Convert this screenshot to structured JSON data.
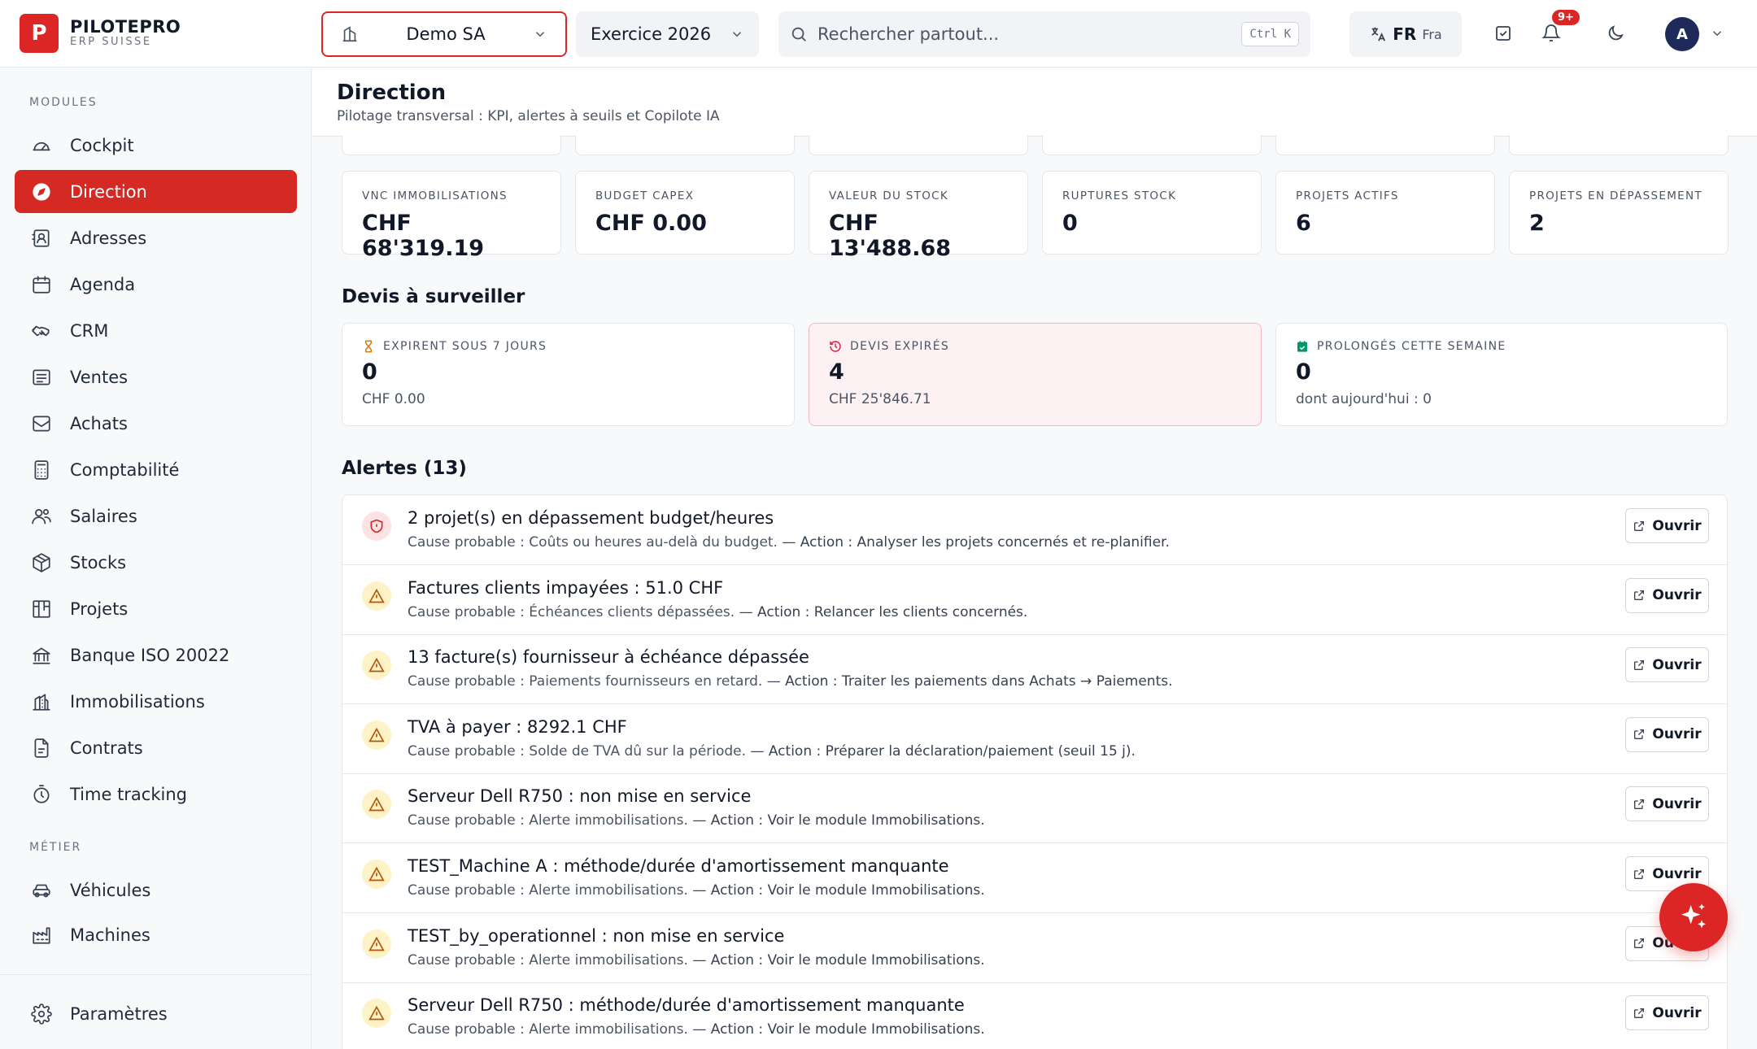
{
  "brand": {
    "name": "PILOTEPRO",
    "tagline": "ERP SUISSE",
    "logo_letter": "P",
    "accent": "#dc2626"
  },
  "header": {
    "company": "Demo SA",
    "year": "Exercice 2026",
    "search_placeholder": "Rechercher partout...",
    "search_shortcut": "Ctrl K",
    "lang_code": "FR",
    "lang_name": "Fra",
    "notif_count": "9+",
    "avatar": "A"
  },
  "sidebar": {
    "modules_label": "MODULES",
    "modules": [
      {
        "label": "Cockpit",
        "icon": "gauge-icon"
      },
      {
        "label": "Direction",
        "icon": "compass-icon",
        "active": true
      },
      {
        "label": "Adresses",
        "icon": "contact-icon"
      },
      {
        "label": "Agenda",
        "icon": "calendar-icon"
      },
      {
        "label": "CRM",
        "icon": "handshake-icon"
      },
      {
        "label": "Ventes",
        "icon": "receipt-icon"
      },
      {
        "label": "Achats",
        "icon": "inbox-icon"
      },
      {
        "label": "Comptabilité",
        "icon": "calculator-icon"
      },
      {
        "label": "Salaires",
        "icon": "users-icon"
      },
      {
        "label": "Stocks",
        "icon": "box-icon"
      },
      {
        "label": "Projets",
        "icon": "kanban-icon"
      },
      {
        "label": "Banque ISO 20022",
        "icon": "bank-icon"
      },
      {
        "label": "Immobilisations",
        "icon": "building-icon"
      },
      {
        "label": "Contrats",
        "icon": "contract-icon"
      },
      {
        "label": "Time tracking",
        "icon": "timer-icon"
      }
    ],
    "metier_label": "MÉTIER",
    "metier": [
      {
        "label": "Véhicules",
        "icon": "car-icon"
      },
      {
        "label": "Machines",
        "icon": "factory-icon"
      }
    ],
    "settings": "Paramètres"
  },
  "page": {
    "title": "Direction",
    "subtitle": "Pilotage transversal : KPI, alertes à seuils et Copilote IA"
  },
  "kpis": [
    {
      "label": "VNC IMMOBILISATIONS",
      "value": "CHF 68'319.19"
    },
    {
      "label": "BUDGET CAPEX",
      "value": "CHF 0.00"
    },
    {
      "label": "VALEUR DU STOCK",
      "value": "CHF 13'488.68"
    },
    {
      "label": "RUPTURES STOCK",
      "value": "0"
    },
    {
      "label": "PROJETS ACTIFS",
      "value": "6"
    },
    {
      "label": "PROJETS EN DÉPASSEMENT",
      "value": "2"
    }
  ],
  "devis": {
    "title": "Devis à surveiller",
    "cards": [
      {
        "label": "EXPIRENT SOUS 7 JOURS",
        "value": "0",
        "sub": "CHF 0.00"
      },
      {
        "label": "DEVIS EXPIRÉS",
        "value": "4",
        "sub": "CHF 25'846.71"
      },
      {
        "label": "PROLONGÉS CETTE SEMAINE",
        "value": "0",
        "sub": "dont aujourd'hui : 0"
      }
    ]
  },
  "alerts": {
    "title": "Alertes (13)",
    "open_label": "Ouvrir",
    "items": [
      {
        "title": "2 projet(s) en dépassement budget/heures",
        "cause": "Cause probable : Coûts ou heures au-delà du budget.",
        "action": " — Action : Analyser les projets concernés et re-planifier.",
        "level": "danger"
      },
      {
        "title": "Factures clients impayées : 51.0 CHF",
        "cause": "Cause probable : Échéances clients dépassées.",
        "action": " — Action : Relancer les clients concernés.",
        "level": "warning"
      },
      {
        "title": "13 facture(s) fournisseur à échéance dépassée",
        "cause": "Cause probable : Paiements fournisseurs en retard.",
        "action": " — Action : Traiter les paiements dans Achats → Paiements.",
        "level": "warning"
      },
      {
        "title": "TVA à payer : 8292.1 CHF",
        "cause": "Cause probable : Solde de TVA dû sur la période.",
        "action": " — Action : Préparer la déclaration/paiement (seuil 15 j).",
        "level": "warning"
      },
      {
        "title": "Serveur Dell R750 : non mise en service",
        "cause": "Cause probable : Alerte immobilisations.",
        "action": " — Action : Voir le module Immobilisations.",
        "level": "warning"
      },
      {
        "title": "TEST_Machine A : méthode/durée d'amortissement manquante",
        "cause": "Cause probable : Alerte immobilisations.",
        "action": " — Action : Voir le module Immobilisations.",
        "level": "warning"
      },
      {
        "title": "TEST_by_operationnel : non mise en service",
        "cause": "Cause probable : Alerte immobilisations.",
        "action": " — Action : Voir le module Immobilisations.",
        "level": "warning"
      },
      {
        "title": "Serveur Dell R750 : méthode/durée d'amortissement manquante",
        "cause": "Cause probable : Alerte immobilisations.",
        "action": " — Action : Voir le module Immobilisations.",
        "level": "warning"
      }
    ]
  }
}
